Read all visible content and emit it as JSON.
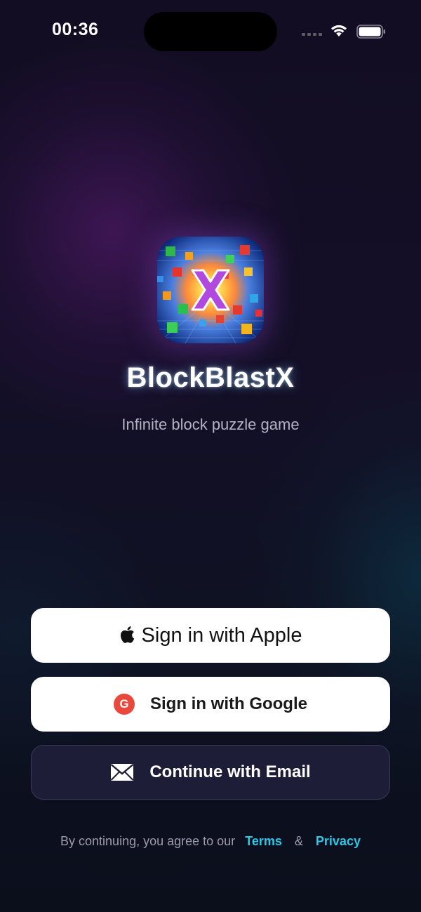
{
  "status_bar": {
    "time": "00:36"
  },
  "app": {
    "title": "BlockBlastX",
    "subtitle": "Infinite block puzzle game",
    "icon_letter": "X"
  },
  "buttons": {
    "apple_label": "Sign in with Apple",
    "google_label": "Sign in with Google",
    "google_icon_letter": "G",
    "email_label": "Continue with Email"
  },
  "footer": {
    "prefix": "By continuing, you agree to our",
    "terms_label": "Terms",
    "ampersand": "&",
    "privacy_label": "Privacy"
  },
  "colors": {
    "background": "#120d22",
    "link": "#2ec8e6",
    "email_button_bg": "#1e1d38",
    "google_badge": "#e8493c"
  },
  "icons": {
    "apple": "apple-logo",
    "google": "google-g",
    "email": "envelope",
    "wifi": "wifi",
    "battery": "battery-full"
  }
}
